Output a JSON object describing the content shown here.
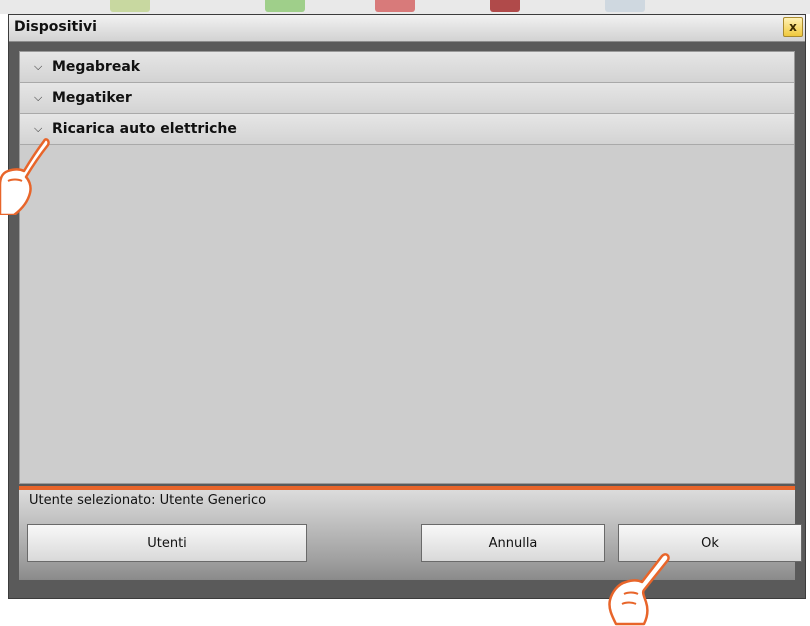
{
  "dialog": {
    "title": "Dispositivi",
    "close_label": "x"
  },
  "devices": [
    {
      "label": "Megabreak"
    },
    {
      "label": "Megatiker"
    },
    {
      "label": "Ricarica auto elettriche"
    }
  ],
  "footer": {
    "selected_user_text": "Utente selezionato: Utente Generico",
    "users_button": "Utenti",
    "cancel_button": "Annulla",
    "ok_button": "Ok"
  },
  "icons": {
    "accordion": "chevron-down-icon",
    "pointer": "hand-pointer-icon"
  },
  "colors": {
    "accent": "#e8652a",
    "close_button": "#f0c93c"
  }
}
